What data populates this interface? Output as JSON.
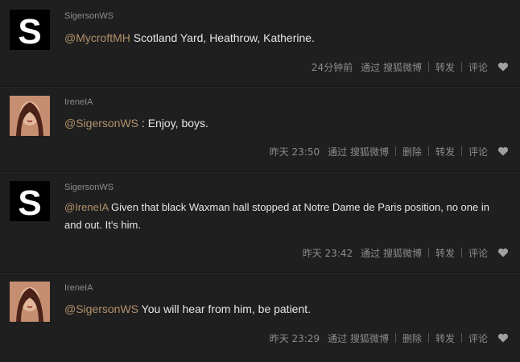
{
  "posts": [
    {
      "author": "SigersonWS",
      "avatar": "s-logo",
      "mention": "@MycroftMH",
      "text": " Scotland Yard, Heathrow, Katherine.",
      "time": "24分钟前",
      "via": "通过 搜狐微博",
      "delete_label": "",
      "repost_label": "转发",
      "comment_label": "评论",
      "like_icon": "heart-icon"
    },
    {
      "author": "IreneIA",
      "avatar": "portrait",
      "mention": "@SigersonWS",
      "text": " : Enjoy, boys.",
      "time": "昨天 23:50",
      "via": "通过 搜狐微博",
      "delete_label": "删除",
      "repost_label": "转发",
      "comment_label": "评论",
      "like_icon": "heart-icon"
    },
    {
      "author": "SigersonWS",
      "avatar": "s-logo",
      "mention": "@IreneIA",
      "text": " Given that black Waxman hall stopped at Notre Dame de Paris position, no one in and out. It's him.",
      "time": "昨天 23:42",
      "via": "通过 搜狐微博",
      "delete_label": "",
      "repost_label": "转发",
      "comment_label": "评论",
      "like_icon": "heart-icon"
    },
    {
      "author": "IreneIA",
      "avatar": "portrait",
      "mention": "@SigersonWS",
      "text": " You will hear from him, be patient.",
      "time": "昨天 23:29",
      "via": "通过 搜狐微博",
      "delete_label": "删除",
      "repost_label": "转发",
      "comment_label": "评论",
      "like_icon": "heart-icon"
    }
  ],
  "colors": {
    "background": "#1f1f1f",
    "mention": "#b2906b",
    "text": "#e6e6e6",
    "meta": "#8c8c8c"
  }
}
